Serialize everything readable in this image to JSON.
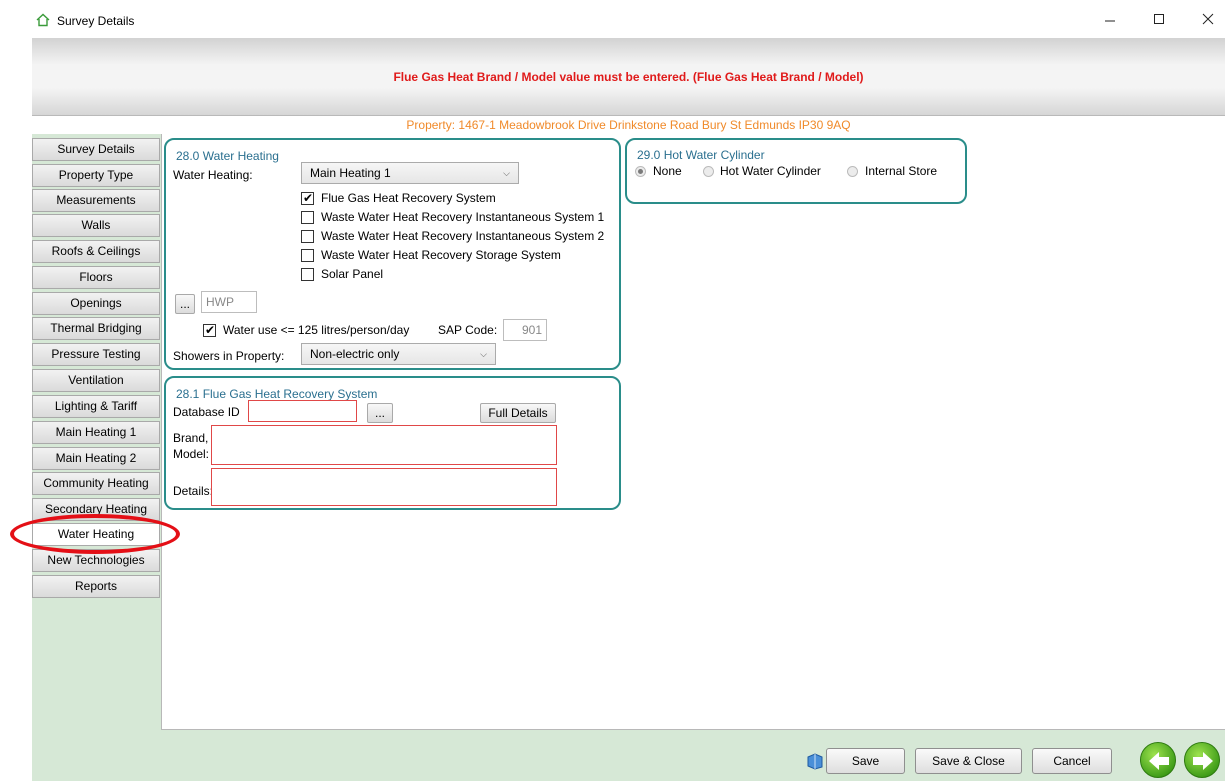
{
  "window": {
    "title": "Survey Details",
    "icon": "home-icon"
  },
  "banner": {
    "message": "Flue Gas Heat Brand / Model value must be entered. (Flue Gas Heat Brand / Model)"
  },
  "property": {
    "text": "Property: 1467-1 Meadowbrook Drive  Drinkstone Road Bury St Edmunds IP30 9AQ"
  },
  "nav": {
    "items": [
      "Survey Details",
      "Property Type",
      "Measurements",
      "Walls",
      "Roofs & Ceilings",
      "Floors",
      "Openings",
      "Thermal Bridging",
      "Pressure Testing",
      "Ventilation",
      "Lighting & Tariff",
      "Main Heating 1",
      "Main Heating 2",
      "Community Heating",
      "Secondary Heating",
      "Water Heating",
      "New Technologies",
      "Reports"
    ],
    "active": "Water Heating"
  },
  "water_heating": {
    "title": "28.0 Water Heating",
    "water_heating_label": "Water Heating:",
    "water_heating_value": "Main Heating 1",
    "options": [
      {
        "label": "Flue Gas Heat Recovery System",
        "checked": true
      },
      {
        "label": "Waste Water Heat Recovery Instantaneous System 1",
        "checked": false
      },
      {
        "label": "Waste Water Heat Recovery Instantaneous System 2",
        "checked": false
      },
      {
        "label": "Waste Water Heat Recovery Storage System",
        "checked": false
      },
      {
        "label": "Solar Panel",
        "checked": false
      }
    ],
    "browse_label": "...",
    "hwp_value": "HWP",
    "water_use_label": "Water use <= 125 litres/person/day",
    "water_use_checked": true,
    "sap_code_label": "SAP Code:",
    "sap_code_value": "901",
    "showers_label": "Showers in Property:",
    "showers_value": "Non-electric only"
  },
  "flue_gas": {
    "title": "28.1 Flue Gas Heat Recovery System",
    "database_id_label": "Database ID",
    "database_id_value": "",
    "browse_label": "...",
    "full_details_label": "Full Details",
    "brand_label_1": "Brand,",
    "brand_label_2": "Model:",
    "details_label": "Details:"
  },
  "cylinder": {
    "title": "29.0 Hot Water Cylinder",
    "options": [
      {
        "label": "None",
        "selected": true
      },
      {
        "label": "Hot Water Cylinder",
        "selected": false
      },
      {
        "label": "Internal Store",
        "selected": false
      }
    ]
  },
  "footer": {
    "save_label": "Save",
    "save_close_label": "Save & Close",
    "cancel_label": "Cancel"
  },
  "colors": {
    "error": "#e01b1b",
    "property": "#f08a2a",
    "group_border": "#2a8d8a",
    "pane_bg": "#d6e8d6"
  }
}
